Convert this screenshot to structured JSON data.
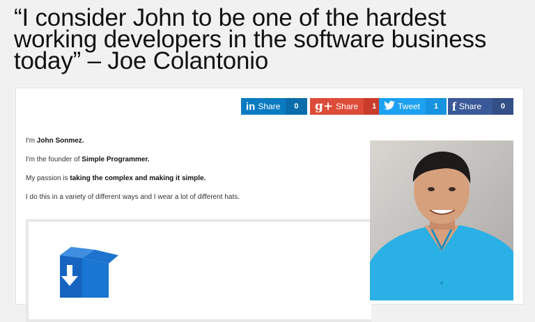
{
  "headline": {
    "line1": "“I consider John to be one of the hardest",
    "line2": "working developers in the software business",
    "line3": "today” – Joe Colantonio"
  },
  "share": {
    "linkedin": {
      "icon": "in",
      "label": "Share",
      "count": "0"
    },
    "googleplus": {
      "icon": "g+",
      "label": "Share",
      "count": "1"
    },
    "twitter": {
      "label": "Tweet",
      "count": "1"
    },
    "facebook": {
      "icon": "f",
      "label": "Share",
      "count": "0"
    }
  },
  "bio": {
    "p1_prefix": "I'm ",
    "p1_bold": "John Sonmez.",
    "p2_prefix": "I'm the founder of ",
    "p2_bold": "Simple Programmer.",
    "p3_prefix": "My passion is ",
    "p3_bold": "taking the complex and making it simple.",
    "p4": "I do this in a variety of different ways and I wear a lot of different hats."
  },
  "colors": {
    "linkedin": "#0b7bc1",
    "googleplus": "#dd4b39",
    "twitter": "#1da1f2",
    "facebook": "#3b5998",
    "download_box": "#1565c0"
  },
  "icons": {
    "download": "download-box-icon",
    "photo": "author-photo"
  }
}
